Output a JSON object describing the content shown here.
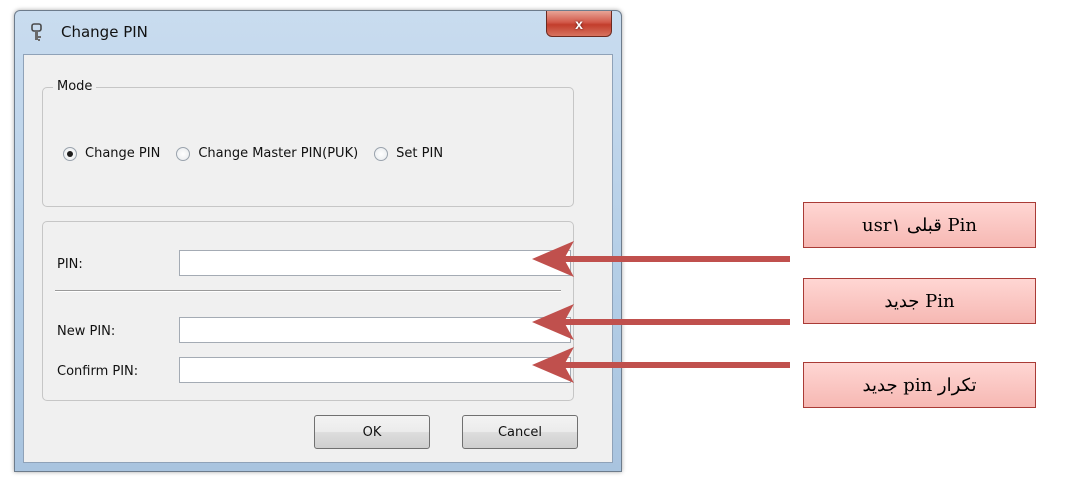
{
  "window": {
    "title": "Change PIN",
    "close_glyph": "x",
    "icon": "pin-app-icon"
  },
  "mode": {
    "legend": "Mode",
    "options": [
      {
        "label": "Change PIN",
        "checked": true
      },
      {
        "label": "Change Master PIN(PUK)",
        "checked": false
      },
      {
        "label": "Set PIN",
        "checked": false
      }
    ]
  },
  "fields": {
    "pin_label": "PIN:",
    "new_pin_label": "New PIN:",
    "confirm_pin_label": "Confirm PIN:"
  },
  "buttons": {
    "ok": "OK",
    "cancel": "Cancel"
  },
  "annotations": {
    "note1": "Pin قبلی usr۱",
    "note2": "Pin جدید",
    "note3": "تکرار pin جدید",
    "arrow_color": "#c0504d",
    "box_border": "#a93b36"
  }
}
